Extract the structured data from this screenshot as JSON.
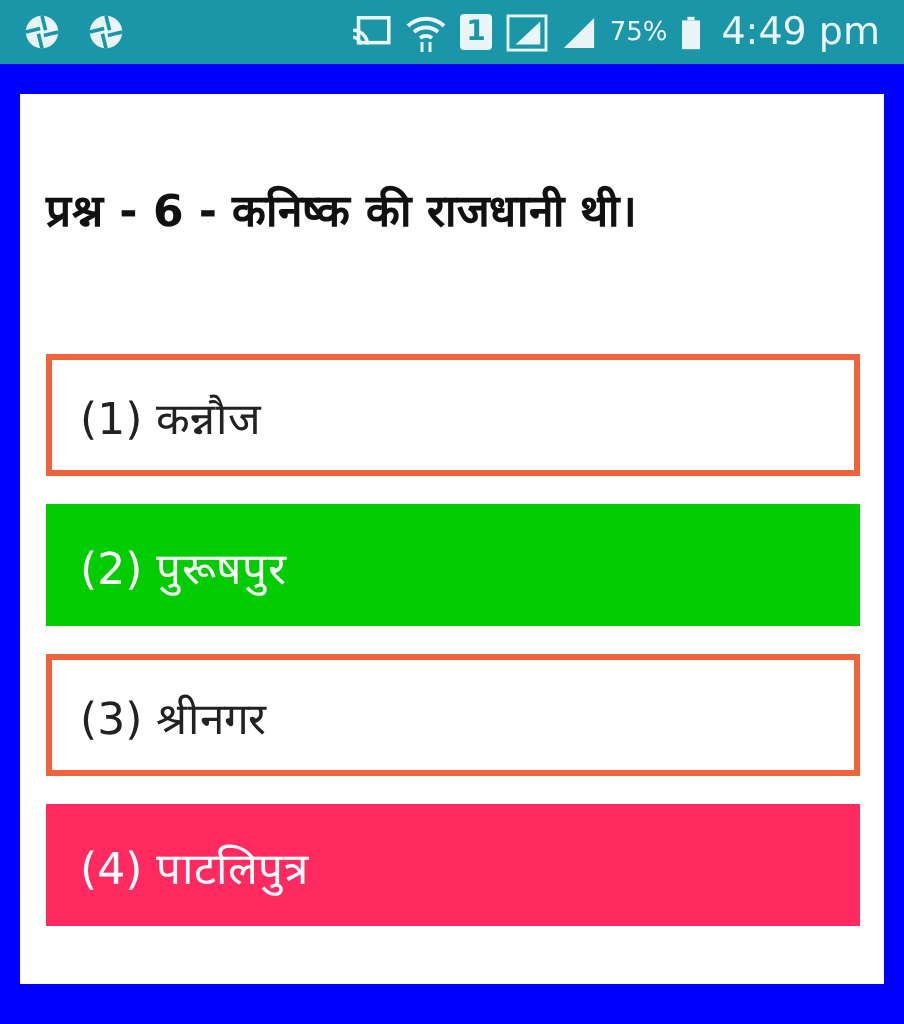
{
  "status_bar": {
    "sim_label": "1",
    "battery": "75%",
    "time": "4:49 pm"
  },
  "question": "प्रश्न - 6 - कनिष्क की राजधानी थी।",
  "options": [
    {
      "label": "(1) कन्नौज",
      "kind": "neutral"
    },
    {
      "label": "(2) पुरूषपुर",
      "kind": "correct"
    },
    {
      "label": "(3) श्रीनगर",
      "kind": "neutral"
    },
    {
      "label": "(4) पाटलिपुत्र",
      "kind": "wrong"
    }
  ]
}
